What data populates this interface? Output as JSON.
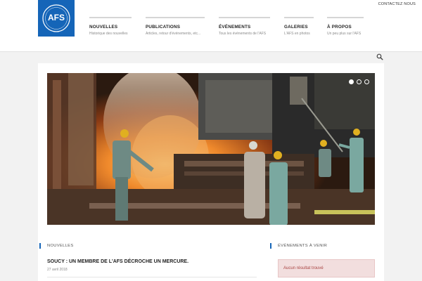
{
  "header": {
    "logo": {
      "text": "AFS",
      "ring_text": "FIERTÉ FONDERIE CANADA",
      "name": "logo-afs"
    },
    "contact_label": "CONTACTEZ NOUS"
  },
  "nav": [
    {
      "title": "NOUVELLES",
      "sub": "Historique des nouvelles"
    },
    {
      "title": "PUBLICATIONS",
      "sub": "Articles, retour d'événements, etc..."
    },
    {
      "title": "ÉVÉNEMENTS",
      "sub": "Tous les événements de l'AFS"
    },
    {
      "title": "GALERIES",
      "sub": "L'AFS en photos"
    },
    {
      "title": "À PROPOS",
      "sub": "Un peu plus sur l'AFS"
    }
  ],
  "search": {
    "icon": "search-icon"
  },
  "slider": {
    "dot_count": 3,
    "active_dot": 0
  },
  "news": {
    "section_title": "NOUVELLES",
    "article_title": "SOUCY : UN MEMBRE DE L'AFS DÉCROCHE UN MERCURE.",
    "article_date": "27 avril 2018"
  },
  "events": {
    "section_title": "ÉVÉNEMENTS À VENIR",
    "empty_message": "Aucun résultat trouvé"
  },
  "colors": {
    "brand": "#1565b8",
    "alert_bg": "#f2dede",
    "alert_text": "#a94442"
  }
}
